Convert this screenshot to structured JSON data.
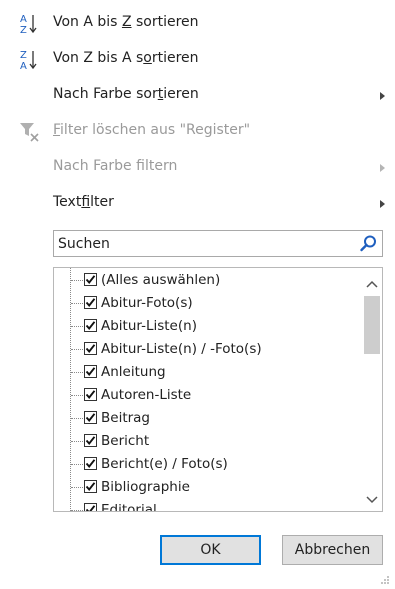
{
  "menu": {
    "sort_az": {
      "pre": "Von A bis ",
      "key": "Z",
      "post": " sortieren"
    },
    "sort_za": {
      "pre": "Von Z bis A s",
      "key": "o",
      "post": "rtieren"
    },
    "sort_by_color": {
      "pre": "Nach Farbe sor",
      "key": "t",
      "post": "ieren"
    },
    "clear_filter": {
      "pre": "",
      "key": "F",
      "post": "ilter löschen aus \"Register\""
    },
    "filter_by_color": {
      "pre": "Nach Farbe f",
      "key": "i",
      "post": "ltern"
    },
    "text_filter": {
      "pre": "Text",
      "key": "f",
      "post": "ilter"
    }
  },
  "icons": {
    "sort_az": "sort-az-icon",
    "sort_za": "sort-za-icon",
    "clear_filter": "clear-filter-icon",
    "search": "magnifier-icon"
  },
  "search": {
    "placeholder": "Suchen",
    "value": ""
  },
  "items": [
    {
      "label": "(Alles auswählen)",
      "checked": true
    },
    {
      "label": "Abitur-Foto(s)",
      "checked": true
    },
    {
      "label": "Abitur-Liste(n)",
      "checked": true
    },
    {
      "label": "Abitur-Liste(n) / -Foto(s)",
      "checked": true
    },
    {
      "label": "Anleitung",
      "checked": true
    },
    {
      "label": "Autoren-Liste",
      "checked": true
    },
    {
      "label": "Beitrag",
      "checked": true
    },
    {
      "label": "Bericht",
      "checked": true
    },
    {
      "label": "Bericht(e) / Foto(s)",
      "checked": true
    },
    {
      "label": "Bibliographie",
      "checked": true
    },
    {
      "label": "Editorial",
      "checked": true
    }
  ],
  "buttons": {
    "ok": "OK",
    "cancel": "Abbrechen"
  },
  "colors": {
    "accent_blue": "#0078d7",
    "icon_blue": "#1f5fbf",
    "disabled": "#9a9a9a"
  }
}
